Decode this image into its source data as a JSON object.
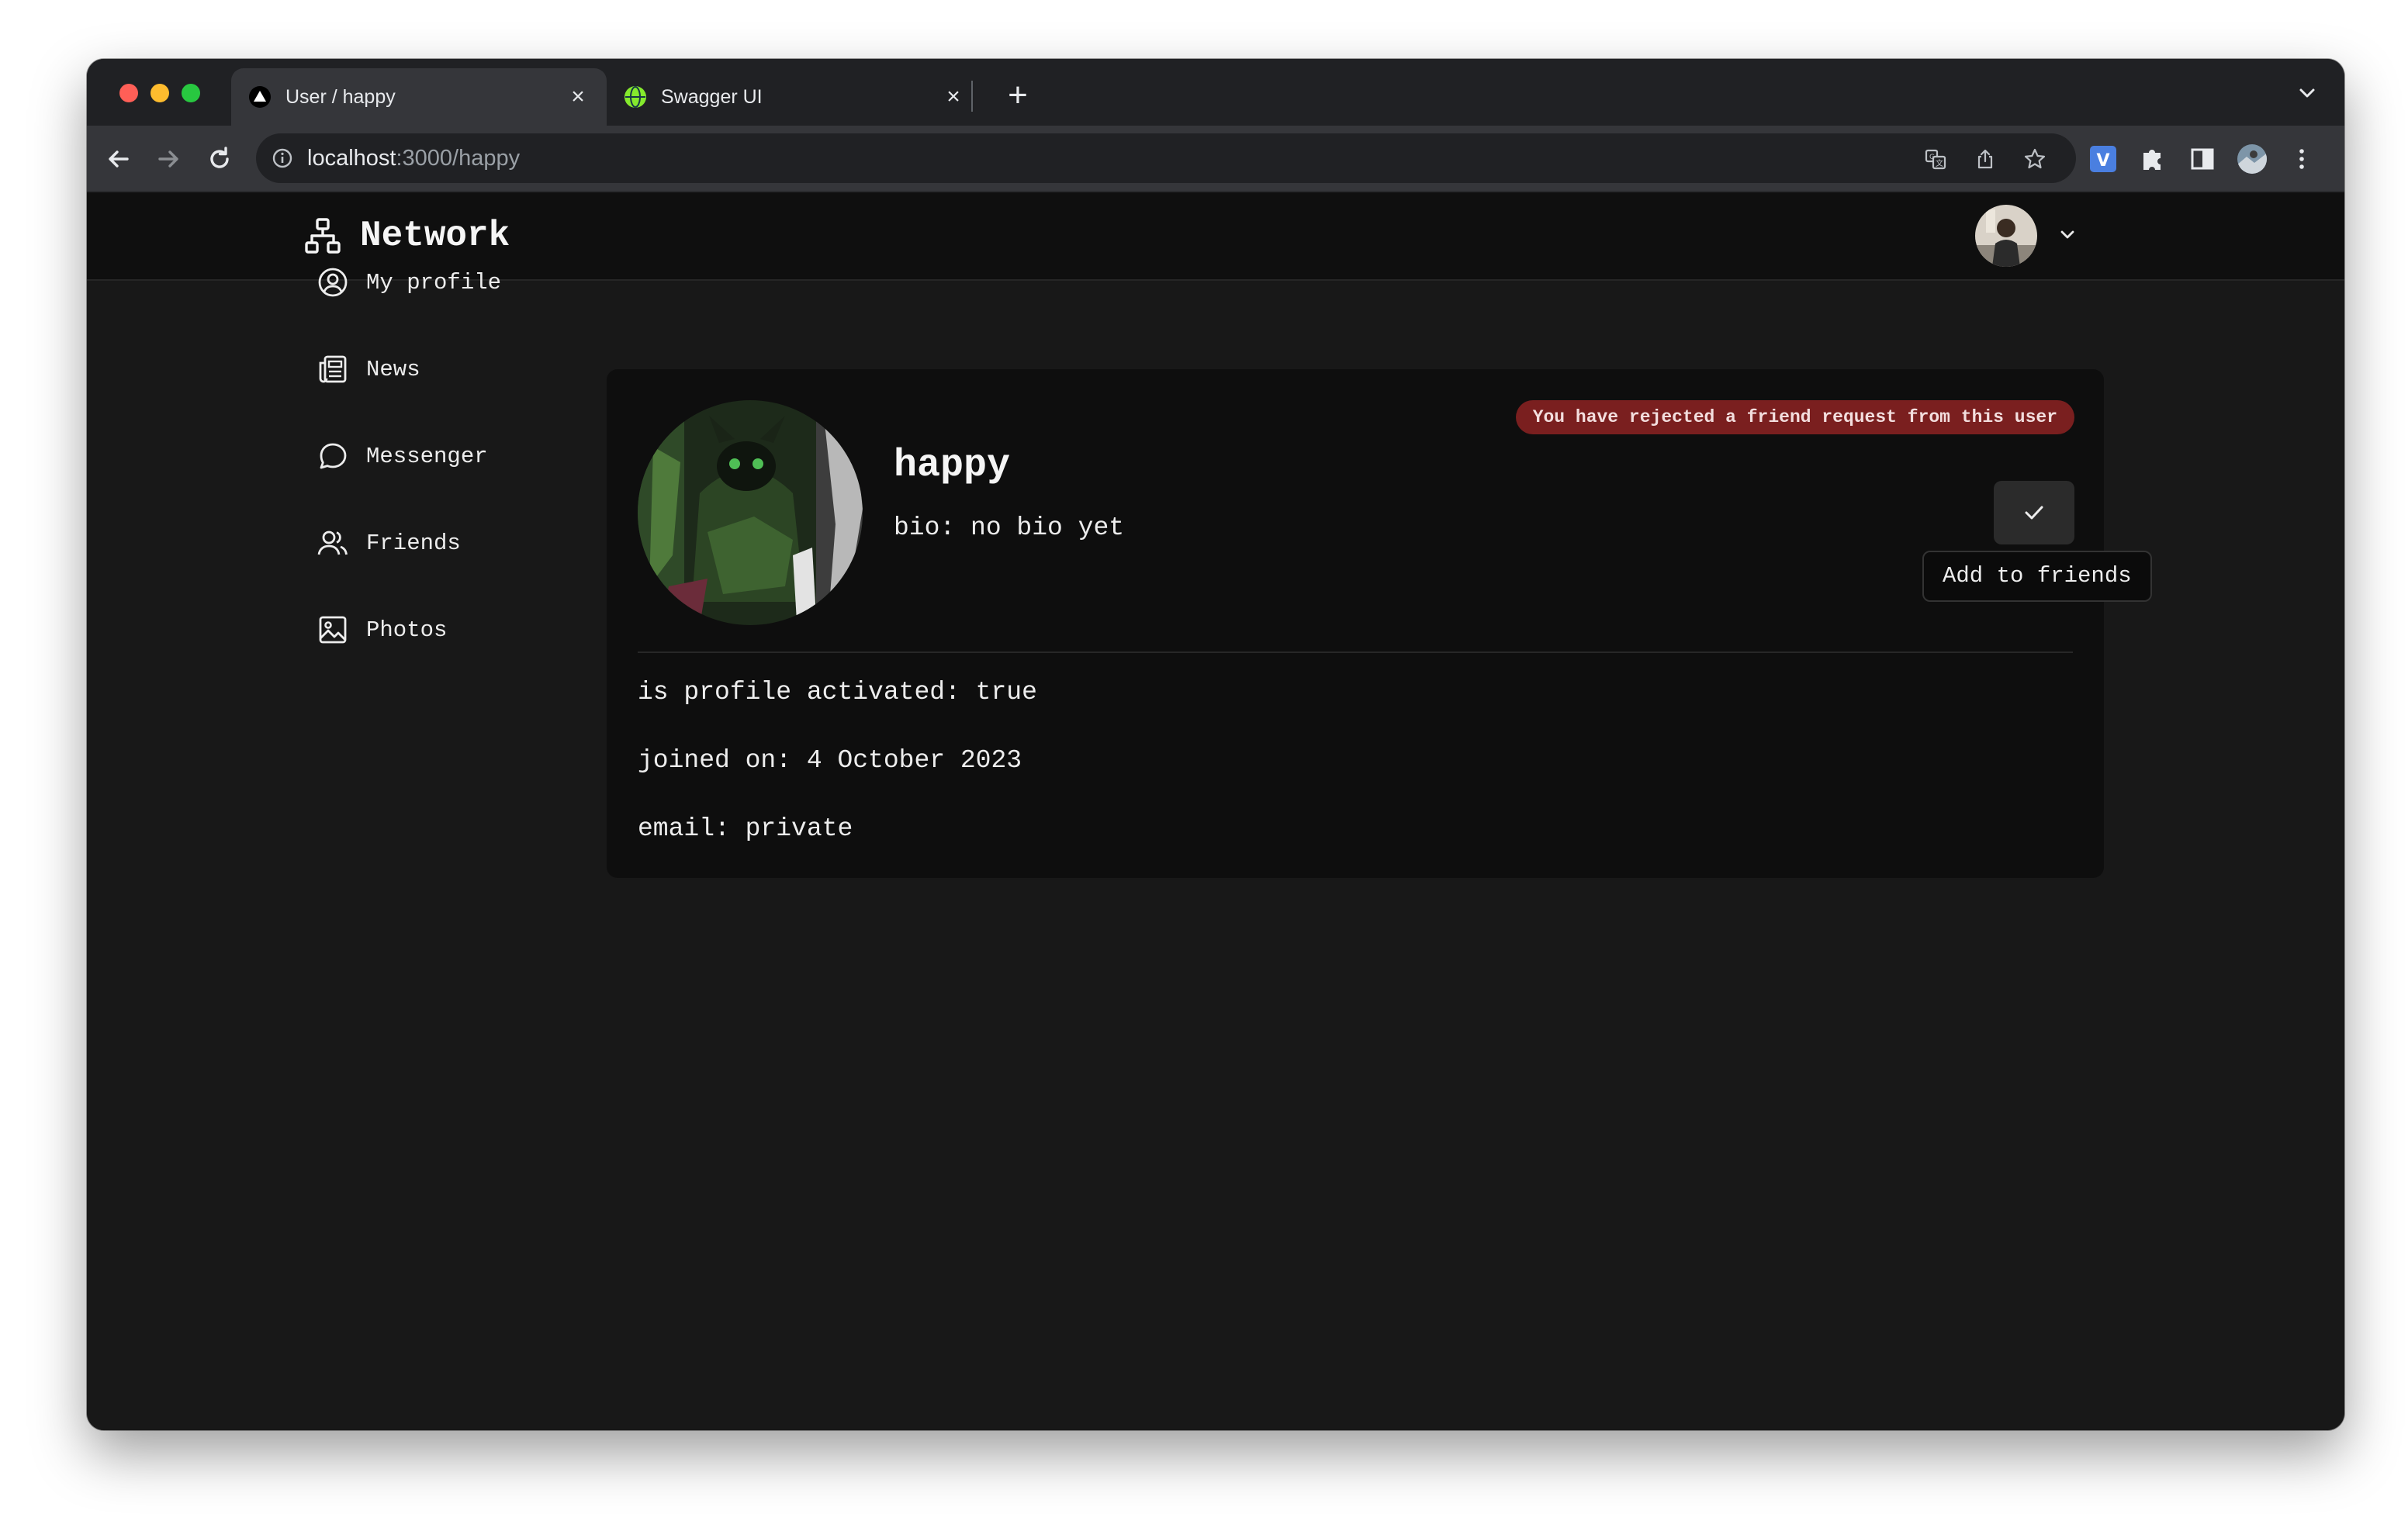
{
  "browser": {
    "tabs": [
      {
        "title": "User / happy",
        "active": true,
        "icon": "vercel-triangle-icon"
      },
      {
        "title": "Swagger UI",
        "active": false,
        "icon": "swagger-globe-icon"
      }
    ],
    "new_tab_label": "+",
    "close_label": "×",
    "url_host": "localhost",
    "url_path": ":3000/happy",
    "extensions": [
      "translate-icon",
      "share-icon",
      "star-icon",
      "v-extension-icon",
      "puzzle-extensions-icon",
      "side-panel-icon",
      "profile-icon",
      "kebab-menu-icon"
    ]
  },
  "header": {
    "brand": "Network",
    "brand_icon": "network-icon"
  },
  "sidebar": {
    "items": [
      {
        "label": "My profile",
        "icon": "user-circle-icon"
      },
      {
        "label": "News",
        "icon": "newspaper-icon"
      },
      {
        "label": "Messenger",
        "icon": "chat-bubble-icon"
      },
      {
        "label": "Friends",
        "icon": "users-icon"
      },
      {
        "label": "Photos",
        "icon": "image-icon"
      }
    ]
  },
  "profile": {
    "username": "happy",
    "bio": "bio: no bio yet",
    "status_badge": "You have rejected a friend request from this user",
    "action_tooltip": "Add to friends",
    "details": [
      "is profile activated: true",
      "joined on: 4 October 2023",
      "email: private"
    ]
  },
  "colors": {
    "page_bg": "#181818",
    "header_bg": "#0f0f0f",
    "card_bg": "#0e0e0e",
    "badge_bg": "#7a1f1f",
    "chrome_dark": "#202124",
    "chrome_toolbar": "#35363a"
  }
}
